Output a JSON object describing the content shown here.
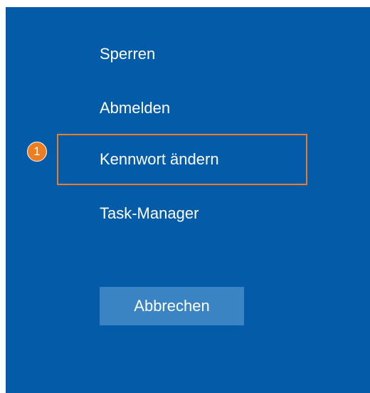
{
  "menu": {
    "items": [
      {
        "id": "lock",
        "label": "Sperren"
      },
      {
        "id": "logout",
        "label": "Abmelden"
      },
      {
        "id": "change-password",
        "label": "Kennwort ändern"
      },
      {
        "id": "task-manager",
        "label": "Task-Manager"
      }
    ]
  },
  "cancel_button": {
    "label": "Abbrechen"
  },
  "annotation": {
    "badge_number": "1",
    "highlight_color": "#e97d2b",
    "badge_color": "#ee7d21"
  },
  "colors": {
    "background": "#045ba7",
    "button": "#3a84c4",
    "text": "#ffffff"
  }
}
